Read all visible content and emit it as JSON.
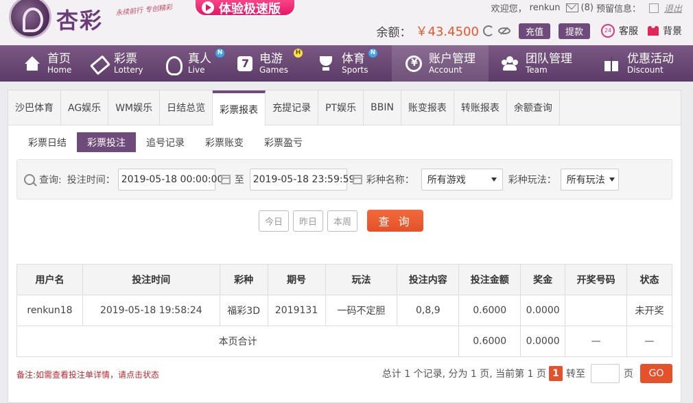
{
  "header": {
    "logo_text": "杏彩",
    "slogan": "永续前行 专创精彩",
    "promo_label": "体验极速版",
    "welcome": "欢迎您，",
    "username": "renkun",
    "mail_count": "(8)",
    "reserved_info": "预留信息：",
    "logout": "退出",
    "balance_label": "余额：",
    "balance_value": "￥43.4500",
    "deposit": "充值",
    "withdraw": "提款",
    "service": "客服",
    "skin": "背景"
  },
  "nav": [
    {
      "zh": "首页",
      "en": "Home",
      "icon": "home-icon",
      "badge": ""
    },
    {
      "zh": "彩票",
      "en": "Lottery",
      "icon": "ticket-icon",
      "badge": ""
    },
    {
      "zh": "真人",
      "en": "Live",
      "icon": "live-dealer-icon",
      "badge": "N"
    },
    {
      "zh": "电游",
      "en": "Games",
      "icon": "slot-game-icon",
      "badge": "H"
    },
    {
      "zh": "体育",
      "en": "Sports",
      "icon": "trophy-icon",
      "badge": "N"
    },
    {
      "zh": "账户管理",
      "en": "Account",
      "icon": "yen-icon",
      "badge": ""
    },
    {
      "zh": "团队管理",
      "en": "Team",
      "icon": "team-icon",
      "badge": ""
    },
    {
      "zh": "优惠活动",
      "en": "Discount",
      "icon": "gift-icon",
      "badge": ""
    }
  ],
  "tabs": [
    "沙巴体育",
    "AG娱乐",
    "WM娱乐",
    "日结总览",
    "彩票报表",
    "充提记录",
    "PT娱乐",
    "BBIN",
    "账变报表",
    "转账报表",
    "余额查询"
  ],
  "active_tab": "彩票报表",
  "subtabs": [
    "彩票日结",
    "彩票投注",
    "追号记录",
    "彩票账变",
    "彩票盈亏"
  ],
  "active_subtab": "彩票投注",
  "search": {
    "query_label": "查询:",
    "time_label": "投注时间：",
    "start_time": "2019-05-18 00:00:00",
    "to_label": "至",
    "end_time": "2019-05-18 23:59:59",
    "game_label": "彩种名称：",
    "game_value": "所有游戏",
    "play_label": "彩种玩法：",
    "play_value": "所有玩法",
    "today": "今日",
    "yesterday": "昨日",
    "this_week": "本周",
    "query_button": "查 询"
  },
  "table": {
    "columns": [
      "用户名",
      "投注时间",
      "彩种",
      "期号",
      "玩法",
      "投注内容",
      "投注金额",
      "奖金",
      "开奖号码",
      "状态"
    ],
    "rows": [
      [
        "renkun18",
        "2019-05-18 19:58:24",
        "福彩3D",
        "2019131",
        "一码不定胆",
        "0,8,9",
        "0.6000",
        "0.0000",
        "",
        "未开奖"
      ]
    ],
    "summary": {
      "label": "本页合计",
      "amount": "0.6000",
      "bonus": "0.0000",
      "draw": "—",
      "status": "—"
    }
  },
  "footer": {
    "note": "备注:如需查看投注单详情，请点击状态",
    "pager_text": "总计 1 个记录, 分为 1 页, 当前第 1 页",
    "current_page": "1",
    "goto_label": "转至",
    "page_unit": "页",
    "go_button": "GO"
  },
  "colors": {
    "brand_purple": "#6e4b7b",
    "accent_orange": "#e4512a",
    "balance_red": "#e8562b",
    "status_green": "#2a8f2a",
    "note_red": "#c0282d"
  }
}
